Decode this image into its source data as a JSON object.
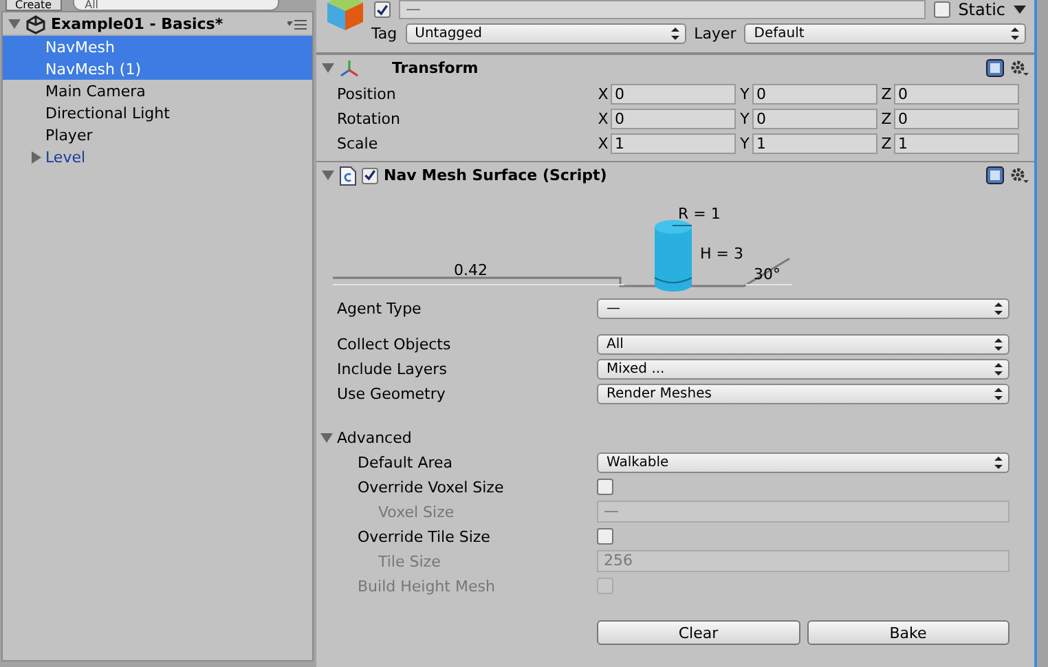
{
  "hierarchy": {
    "create_button": "Create",
    "search": {
      "value": "All"
    },
    "scene": {
      "name": "Example01 - Basics*",
      "expanded": true
    },
    "items": [
      {
        "label": "NavMesh",
        "kind": "object",
        "selected": true
      },
      {
        "label": "NavMesh (1)",
        "kind": "object",
        "selected": true
      },
      {
        "label": "Main Camera",
        "kind": "object",
        "selected": false
      },
      {
        "label": "Directional Light",
        "kind": "object",
        "selected": false
      },
      {
        "label": "Player",
        "kind": "object",
        "selected": false
      },
      {
        "label": "Level",
        "kind": "prefab",
        "selected": false,
        "expanded": false
      }
    ]
  },
  "inspector": {
    "active": true,
    "name": {
      "value": "—"
    },
    "static": {
      "label": "Static",
      "checked": false
    },
    "tag": {
      "label": "Tag",
      "value": "Untagged"
    },
    "layer": {
      "label": "Layer",
      "value": "Default"
    },
    "transform": {
      "title": "Transform",
      "expanded": true,
      "rows": [
        {
          "label": "Position",
          "fields": [
            {
              "axis": "X",
              "value": "0"
            },
            {
              "axis": "Y",
              "value": "0"
            },
            {
              "axis": "Z",
              "value": "0"
            }
          ]
        },
        {
          "label": "Rotation",
          "fields": [
            {
              "axis": "X",
              "value": "0"
            },
            {
              "axis": "Y",
              "value": "0"
            },
            {
              "axis": "Z",
              "value": "0"
            }
          ]
        },
        {
          "label": "Scale",
          "fields": [
            {
              "axis": "X",
              "value": "1"
            },
            {
              "axis": "Y",
              "value": "1"
            },
            {
              "axis": "Z",
              "value": "1"
            }
          ]
        }
      ]
    },
    "navmesh_surface": {
      "title": "Nav Mesh Surface (Script)",
      "expanded": true,
      "enabled": true,
      "diagram": {
        "radius": "R = 1",
        "height": "H = 3",
        "step": "0.42",
        "slope": "30°"
      },
      "fields": [
        {
          "kind": "dropdown",
          "label": "Agent Type",
          "value": "—",
          "disabled": false
        },
        {
          "kind": "spacer"
        },
        {
          "kind": "dropdown",
          "label": "Collect Objects",
          "value": "All",
          "disabled": false
        },
        {
          "kind": "dropdown",
          "label": "Include Layers",
          "value": "Mixed ...",
          "disabled": false
        },
        {
          "kind": "dropdown",
          "label": "Use Geometry",
          "value": "Render Meshes",
          "disabled": false
        },
        {
          "kind": "spacer"
        },
        {
          "kind": "foldout",
          "label": "Advanced",
          "expanded": true,
          "disabled": false,
          "children": [
            {
              "kind": "dropdown",
              "label": "Default Area",
              "value": "Walkable",
              "disabled": false
            },
            {
              "kind": "checkbox",
              "label": "Override Voxel Size",
              "checked": false,
              "disabled": false,
              "children": [
                {
                  "kind": "text",
                  "label": "Voxel Size",
                  "value": "—",
                  "disabled": true
                }
              ]
            },
            {
              "kind": "checkbox",
              "label": "Override Tile Size",
              "checked": false,
              "disabled": false,
              "children": [
                {
                  "kind": "text",
                  "label": "Tile Size",
                  "value": "256",
                  "disabled": true
                }
              ]
            },
            {
              "kind": "checkbox",
              "label": "Build Height Mesh",
              "checked": false,
              "disabled": true
            }
          ]
        }
      ],
      "buttons": [
        "Clear",
        "Bake"
      ]
    }
  }
}
